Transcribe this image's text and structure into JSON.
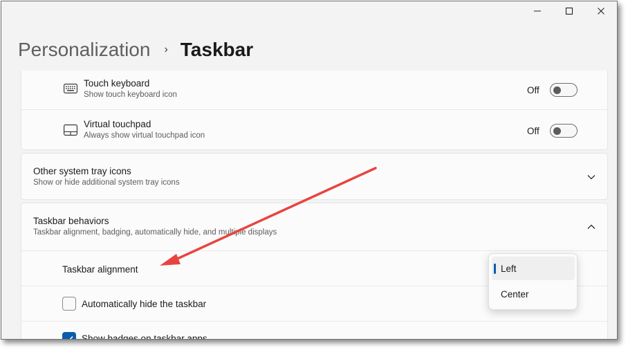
{
  "window": {
    "buttons": {
      "minimize": "minimize-icon",
      "maximize": "maximize-icon",
      "close": "close-icon"
    }
  },
  "breadcrumb": {
    "parent": "Personalization",
    "separator": "›",
    "current": "Taskbar"
  },
  "tray_corner_icons": [
    {
      "icon": "keyboard-icon",
      "title": "Touch keyboard",
      "description": "Show touch keyboard icon",
      "state_label": "Off",
      "on": false
    },
    {
      "icon": "touchpad-icon",
      "title": "Virtual touchpad",
      "description": "Always show virtual touchpad icon",
      "state_label": "Off",
      "on": false
    }
  ],
  "other_tray": {
    "title": "Other system tray icons",
    "description": "Show or hide additional system tray icons",
    "expanded": false
  },
  "behaviors": {
    "title": "Taskbar behaviors",
    "description": "Taskbar alignment, badging, automatically hide, and multiple displays",
    "expanded": true,
    "alignment": {
      "label": "Taskbar alignment",
      "options": [
        "Left",
        "Center"
      ],
      "selected": "Left"
    },
    "auto_hide": {
      "label": "Automatically hide the taskbar",
      "checked": false
    },
    "badges": {
      "label": "Show badges on taskbar apps",
      "checked": true
    }
  },
  "colors": {
    "accent": "#0b5cad",
    "annotation_arrow": "#e8443f",
    "window_bg": "#f3f3f3",
    "card_bg": "#fbfbfb"
  }
}
